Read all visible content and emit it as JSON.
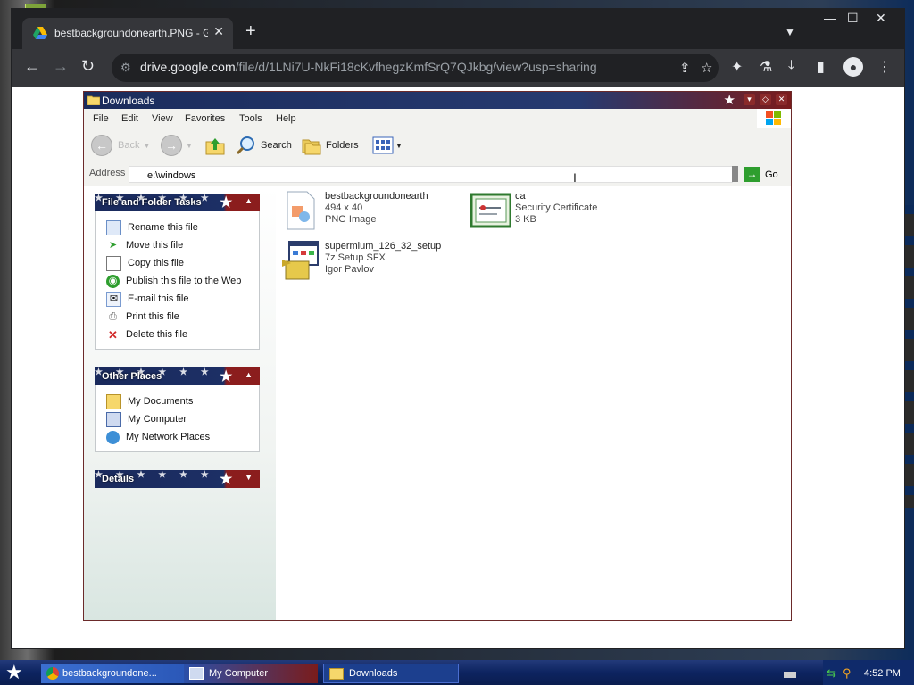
{
  "browser": {
    "tab": {
      "title": "bestbackgroundonearth.PNG - Google Drive"
    },
    "omnibox": {
      "host": "drive.google.com",
      "path": "/file/d/1LNi7U-NkFi18cKvfhegzKmfSrQ7QJkbg/view?usp=sharing"
    }
  },
  "explorer": {
    "title": "Downloads",
    "menu": [
      "File",
      "Edit",
      "View",
      "Favorites",
      "Tools",
      "Help"
    ],
    "toolbar": {
      "back": "Back",
      "search": "Search",
      "folders": "Folders"
    },
    "address": {
      "label": "Address",
      "value": "e:\\windows",
      "go": "Go"
    },
    "file_tasks": {
      "title": "File and Folder Tasks",
      "items": [
        "Rename this file",
        "Move this file",
        "Copy this file",
        "Publish this file to the Web",
        "E-mail this file",
        "Print this file",
        "Delete this file"
      ]
    },
    "other_places": {
      "title": "Other Places",
      "items": [
        "My Documents",
        "My Computer",
        "My Network Places"
      ]
    },
    "details": {
      "title": "Details"
    },
    "files": [
      {
        "name": "bestbackgroundonearth",
        "line2": "494 x 40",
        "line3": "PNG Image",
        "icon": "png-image-icon"
      },
      {
        "name": "ca",
        "line2": "Security Certificate",
        "line3": "3 KB",
        "icon": "certificate-icon"
      },
      {
        "name": "supermium_126_32_setup",
        "line2": "7z Setup SFX",
        "line3": "Igor Pavlov",
        "icon": "installer-icon"
      }
    ]
  },
  "taskbar": {
    "buttons": [
      "bestbackgroundone...",
      "My Computer",
      "Downloads"
    ],
    "clock": "4:52 PM"
  },
  "colors": {
    "chrome_dark": "#202124",
    "xp_title_blue": "#1b2c5c",
    "xp_title_red": "#7a1c1c",
    "taskbar_blue": "#0d2460"
  }
}
